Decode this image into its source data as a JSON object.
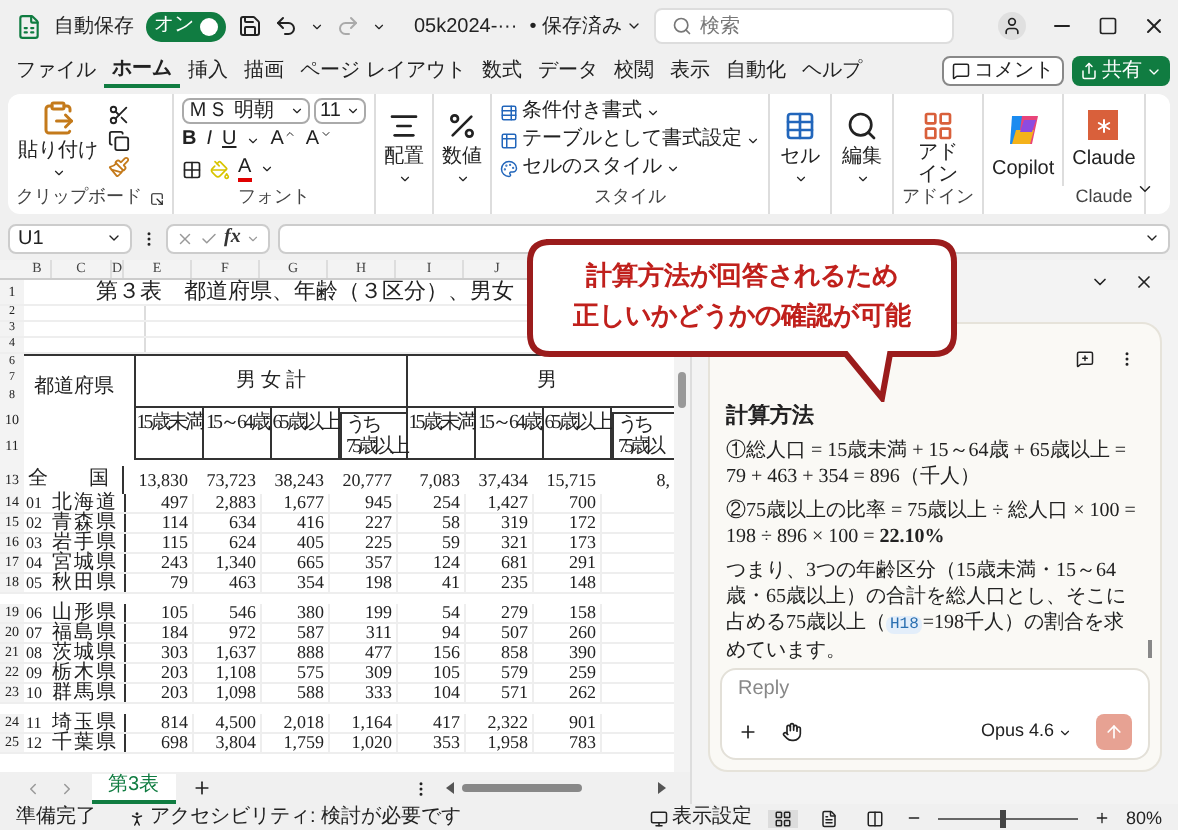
{
  "title_bar": {
    "autosave_label": "自動保存",
    "autosave_toggle": {
      "label": "オン",
      "on": true
    },
    "file_name": "05k2024-···",
    "save_status": "• 保存済み",
    "search": {
      "placeholder": "検索"
    }
  },
  "menu_tabs": [
    {
      "label": "ファイル",
      "selected": false
    },
    {
      "label": "ホーム",
      "selected": true
    },
    {
      "label": "挿入",
      "selected": false
    },
    {
      "label": "描画",
      "selected": false
    },
    {
      "label": "ページ レイアウト",
      "selected": false
    },
    {
      "label": "数式",
      "selected": false
    },
    {
      "label": "データ",
      "selected": false
    },
    {
      "label": "校閲",
      "selected": false
    },
    {
      "label": "表示",
      "selected": false
    },
    {
      "label": "自動化",
      "selected": false
    },
    {
      "label": "ヘルプ",
      "selected": false
    }
  ],
  "comment_button": "コメント",
  "share_button": "共有",
  "ribbon": {
    "clipboard": {
      "paste": "貼り付け",
      "label": "クリップボード"
    },
    "font": {
      "name": "ＭＳ 明朝",
      "size": "11",
      "format_buttons": [
        "B",
        "I",
        "U"
      ],
      "grow": "A",
      "shrink": "A",
      "font_color": "A",
      "label": "フォント"
    },
    "alignment": "配置",
    "number": "数値",
    "styles": {
      "items": [
        "条件付き書式",
        "テーブルとして書式設定",
        "セルのスタイル"
      ],
      "label": "スタイル"
    },
    "cells": "セル",
    "editing": "編集",
    "addins": {
      "button": "アドイン",
      "label": "アドイン"
    },
    "copilot": "Copilot",
    "claude": {
      "button": "Claude",
      "label": "Claude"
    }
  },
  "formula_bar": {
    "name_box": "U1",
    "fx": "fx"
  },
  "sheet": {
    "column_letters": [
      "B",
      "C",
      "D",
      "E",
      "F",
      "G",
      "H",
      "I",
      "J"
    ],
    "title_row": {
      "number": "1",
      "text": "第３表　都道府県、年齢（３区分）、男女"
    },
    "blank_rows": [
      "2",
      "3",
      "4"
    ],
    "upper_header_rows": [
      "6",
      "7",
      "8"
    ],
    "lower_header_rows": [
      "10",
      "11"
    ],
    "prefecture_header": "都道府県",
    "groups": [
      "男 女 計",
      "男"
    ],
    "subheaders": [
      {
        "lines": [
          "15歳未満"
        ]
      },
      {
        "lines": [
          "15～64歳"
        ]
      },
      {
        "lines": [
          "65歳以上"
        ]
      },
      {
        "lines": [
          "うち",
          "75歳以上"
        ]
      },
      {
        "lines": [
          "15歳未満"
        ]
      },
      {
        "lines": [
          "15～64歳"
        ]
      },
      {
        "lines": [
          "65歳以上"
        ]
      },
      {
        "lines": [
          "うち",
          "75歳以"
        ]
      }
    ],
    "national": {
      "number": "13",
      "left": "全",
      "right": "国",
      "values": [
        "13,830",
        "73,723",
        "38,243",
        "20,777",
        "7,083",
        "37,434",
        "15,715",
        "8,"
      ]
    },
    "blocks": [
      [
        {
          "number": "14",
          "code": "01",
          "pref": [
            "北",
            "海",
            "道"
          ],
          "values": [
            "497",
            "2,883",
            "1,677",
            "945",
            "254",
            "1,427",
            "700"
          ]
        },
        {
          "number": "15",
          "code": "02",
          "pref": [
            "青",
            "森",
            "県"
          ],
          "values": [
            "114",
            "634",
            "416",
            "227",
            "58",
            "319",
            "172"
          ]
        },
        {
          "number": "16",
          "code": "03",
          "pref": [
            "岩",
            "手",
            "県"
          ],
          "values": [
            "115",
            "624",
            "405",
            "225",
            "59",
            "321",
            "173"
          ]
        },
        {
          "number": "17",
          "code": "04",
          "pref": [
            "宮",
            "城",
            "県"
          ],
          "values": [
            "243",
            "1,340",
            "665",
            "357",
            "124",
            "681",
            "291"
          ]
        },
        {
          "number": "18",
          "code": "05",
          "pref": [
            "秋",
            "田",
            "県"
          ],
          "values": [
            "79",
            "463",
            "354",
            "198",
            "41",
            "235",
            "148"
          ]
        }
      ],
      [
        {
          "number": "19",
          "code": "06",
          "pref": [
            "山",
            "形",
            "県"
          ],
          "values": [
            "105",
            "546",
            "380",
            "199",
            "54",
            "279",
            "158"
          ]
        },
        {
          "number": "20",
          "code": "07",
          "pref": [
            "福",
            "島",
            "県"
          ],
          "values": [
            "184",
            "972",
            "587",
            "311",
            "94",
            "507",
            "260"
          ]
        },
        {
          "number": "21",
          "code": "08",
          "pref": [
            "茨",
            "城",
            "県"
          ],
          "values": [
            "303",
            "1,637",
            "888",
            "477",
            "156",
            "858",
            "390"
          ]
        },
        {
          "number": "22",
          "code": "09",
          "pref": [
            "栃",
            "木",
            "県"
          ],
          "values": [
            "203",
            "1,108",
            "575",
            "309",
            "105",
            "579",
            "259"
          ]
        },
        {
          "number": "23",
          "code": "10",
          "pref": [
            "群",
            "馬",
            "県"
          ],
          "values": [
            "203",
            "1,098",
            "588",
            "333",
            "104",
            "571",
            "262"
          ]
        }
      ],
      [
        {
          "number": "24",
          "code": "11",
          "pref": [
            "埼",
            "玉",
            "県"
          ],
          "values": [
            "814",
            "4,500",
            "2,018",
            "1,164",
            "417",
            "2,322",
            "901"
          ]
        },
        {
          "number": "25",
          "code": "12",
          "pref": [
            "千",
            "葉",
            "県"
          ],
          "values": [
            "698",
            "3,804",
            "1,759",
            "1,020",
            "353",
            "1,958",
            "783"
          ]
        }
      ]
    ]
  },
  "sheet_tabs": [
    {
      "label": "第3表",
      "selected": true
    }
  ],
  "side_panel": {
    "heading": "計算方法",
    "paragraphs": [
      "①総人口 = 15歳未満 + 15～64歳 + 65歳以上 = 79 + 463 + 354 = 896（千人）",
      "②75歳以上の比率 = 75歳以上 ÷ 総人口 × 100 = 198 ÷ 896 × 100 = **22.10%**"
    ],
    "summary": {
      "before": "つまり、3つの年齢区分（15歳未満・15～64歳・65歳以上）の合計を総人口とし、そこに占める75歳以上（",
      "chip": "H18",
      "after": "=198千人）の割合を求めています。"
    },
    "reply": {
      "placeholder": "Reply",
      "model": "Opus 4.6"
    }
  },
  "callout": {
    "lines": [
      "計算方法が回答されるため",
      "正しいかどうかの確認が可能"
    ]
  },
  "status_bar": {
    "ready": "準備完了",
    "accessibility": "アクセシビリティ: 検討が必要です",
    "display_settings": "表示設定",
    "views": [
      {
        "selected": true
      },
      {
        "selected": false
      },
      {
        "selected": false
      }
    ],
    "zoom": {
      "level": 0.45,
      "reading": "80%"
    }
  }
}
